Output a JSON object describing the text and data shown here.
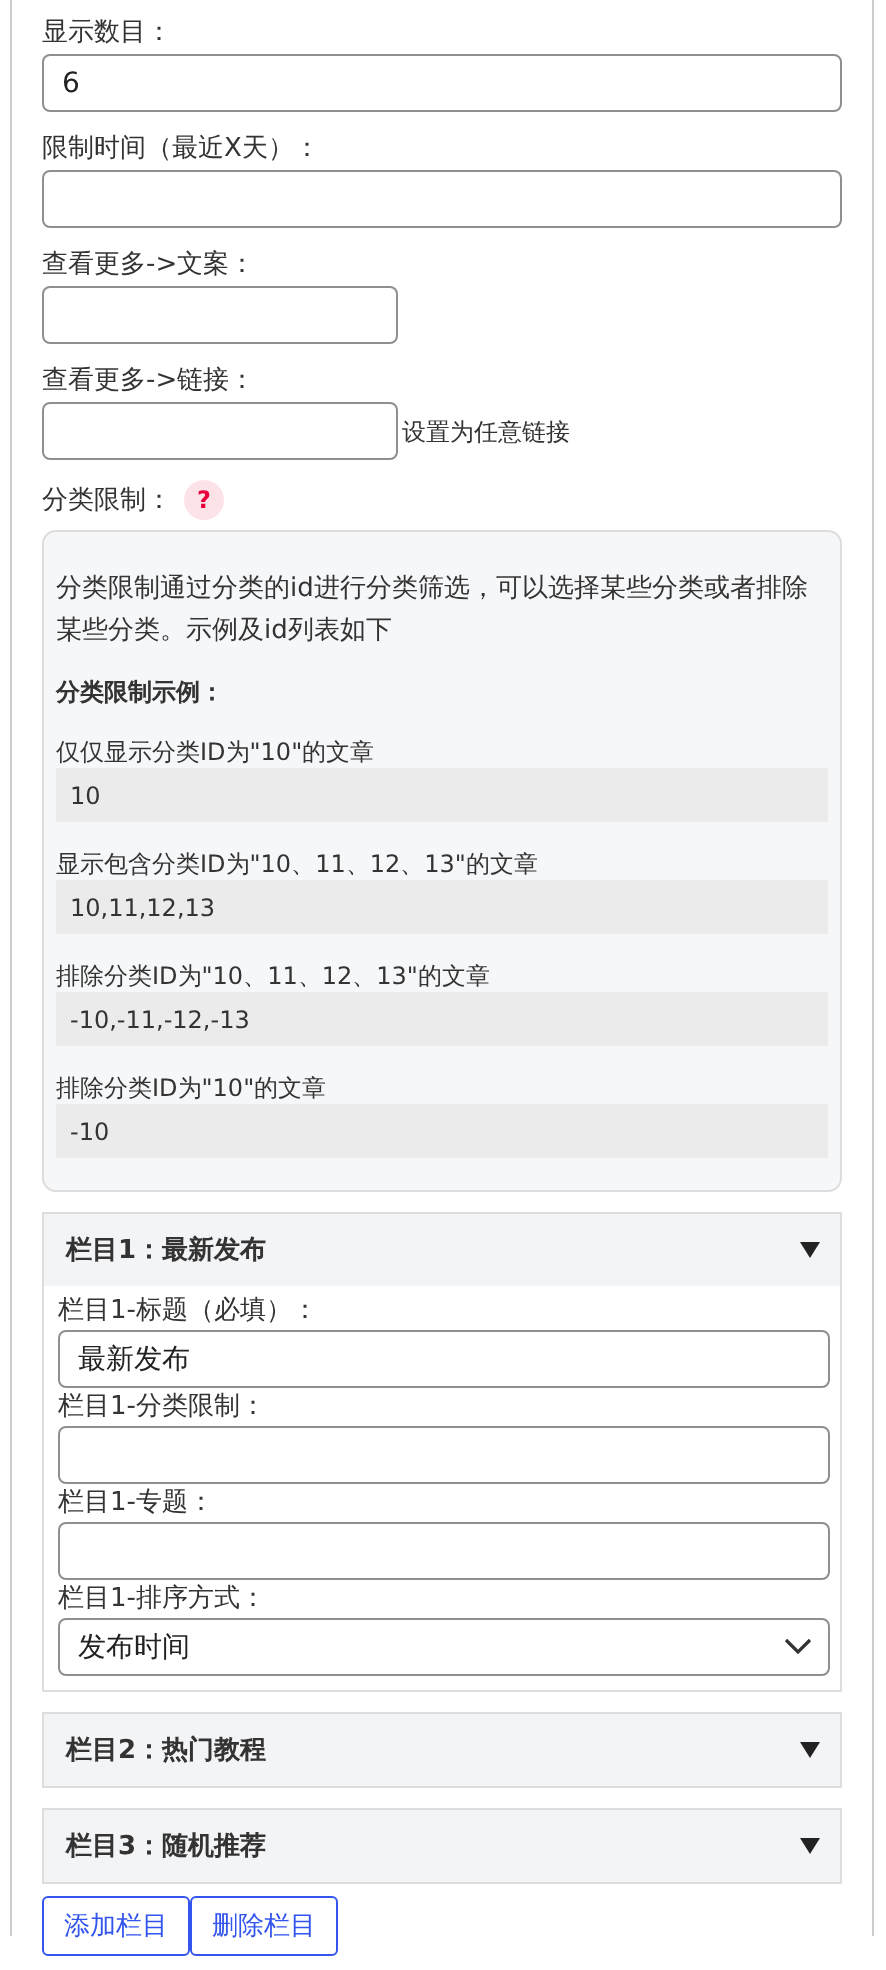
{
  "settings": [
    {
      "label": "显示数目：",
      "value": "6",
      "kind": "wide"
    },
    {
      "label": "限制时间（最近X天）：",
      "kind": "wide"
    },
    {
      "label": "查看更多->文案：",
      "kind": "narrow"
    },
    {
      "label": "查看更多->链接：",
      "kind": "narrow",
      "note": "设置为任意链接"
    }
  ],
  "category_limit": {
    "label": "分类限制：",
    "help": "?",
    "description": "分类限制通过分类的id进行分类筛选，可以选择某些分类或者排除某些分类。示例及id列表如下",
    "examples_title": "分类限制示例：",
    "examples": [
      {
        "caption": "仅仅显示分类ID为\"10\"的文章",
        "code": "10"
      },
      {
        "caption": "显示包含分类ID为\"10、11、12、13\"的文章",
        "code": "10,11,12,13"
      },
      {
        "caption": "排除分类ID为\"10、11、12、13\"的文章",
        "code": "-10,-11,-12,-13"
      },
      {
        "caption": "排除分类ID为\"10\"的文章",
        "code": "-10"
      }
    ]
  },
  "columns": [
    {
      "title": "栏目1：最新发布",
      "expanded": true,
      "fields": [
        {
          "label": "栏目1-标题（必填）：",
          "kind": "text",
          "value": "最新发布"
        },
        {
          "label": "栏目1-分类限制：",
          "kind": "text"
        },
        {
          "label": "栏目1-专题：",
          "kind": "text"
        },
        {
          "label": "栏目1-排序方式：",
          "kind": "select",
          "value": "发布时间"
        }
      ]
    },
    {
      "title": "栏目2：热门教程",
      "expanded": false
    },
    {
      "title": "栏目3：随机推荐",
      "expanded": false
    }
  ],
  "buttons": [
    "添加栏目",
    "删除栏目"
  ]
}
